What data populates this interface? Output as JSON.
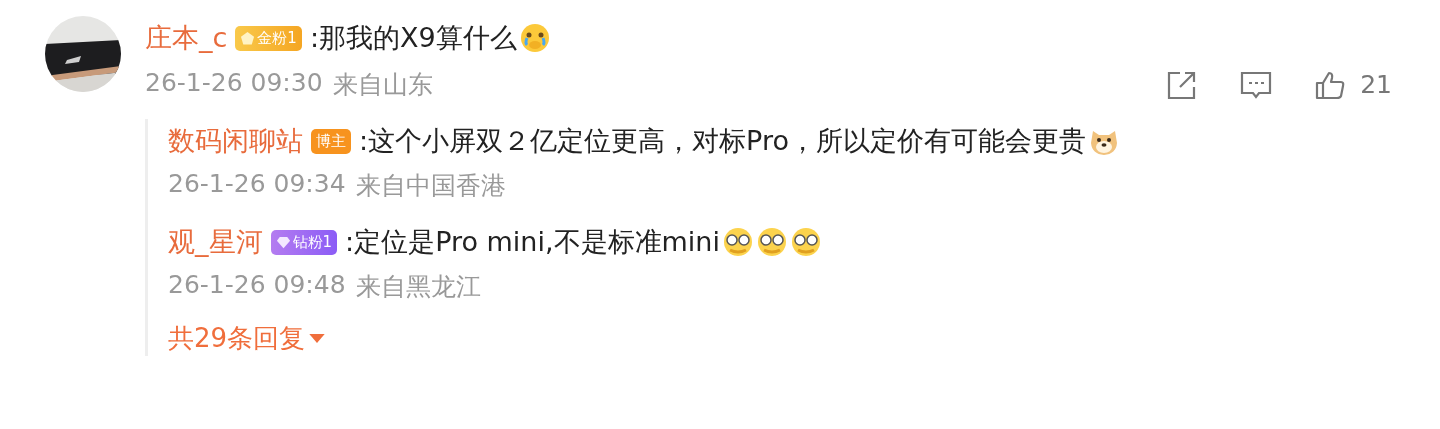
{
  "comment": {
    "author": "庄本_c",
    "badge": {
      "kind": "gold",
      "label": "金粉1"
    },
    "text": ":那我的X9算什么",
    "emojis": [
      {
        "kind": "cry"
      }
    ],
    "time": "26-1-26 09:30",
    "location": "来自山东",
    "likes": "21",
    "replies": [
      {
        "author": "数码闲聊站",
        "badge": {
          "kind": "blogger",
          "label": "博主"
        },
        "text": ":这个小屏双２亿定位更高，对标Pro，所以定价有可能会更贵",
        "emojis": [
          {
            "kind": "doge"
          }
        ],
        "time": "26-1-26 09:34",
        "location": "来自中国香港"
      },
      {
        "author": "观_星河",
        "badge": {
          "kind": "diamond",
          "label": "钻粉1"
        },
        "text": ":定位是Pro mini,不是标准mini",
        "emojis": [
          {
            "kind": "glasses"
          },
          {
            "kind": "glasses"
          },
          {
            "kind": "glasses"
          }
        ],
        "time": "26-1-26 09:48",
        "location": "来自黑龙江"
      }
    ],
    "more_replies": "共29条回复"
  }
}
